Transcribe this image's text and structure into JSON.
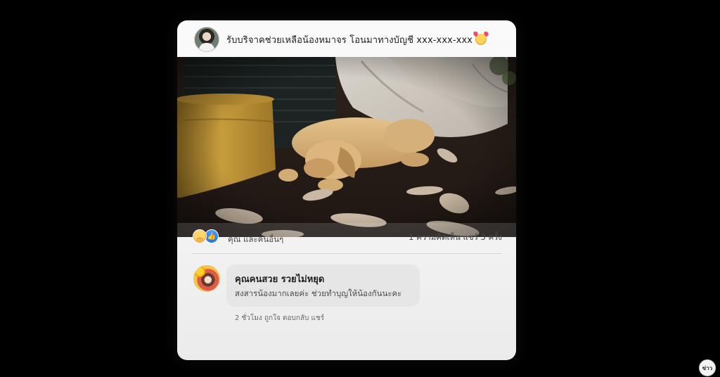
{
  "post": {
    "author_avatar_icon": "profile-photo-woman",
    "caption": "รับบริจาคช่วยเหลือน้องหมาจร โอนมาทางบัญชี xxx-xxx-xxx",
    "caption_emoji": "smiling-face-with-hearts-icon",
    "photo_description_icon": "puppy-photo",
    "reactions": {
      "icons": [
        "care-reaction-icon",
        "like-reaction-icon"
      ],
      "text": "คุณ และคนอื่นๆ"
    },
    "stats_text": "1 ความคิดเห็น แชร์ 3 ครั้ง"
  },
  "comment": {
    "avatar_icon": "profile-photo-sunflower",
    "author": "คุณคนสวย รวยไม่หยุด",
    "text": "สงสารน้องมากเลยค่ะ ช่วยทำบุญให้น้องกันนะคะ",
    "actions": "2 ชั่วโมง ถูกใจ ตอบกลับ แชร์"
  },
  "watermark": {
    "label": "ข่าว"
  },
  "colors": {
    "background": "#000000",
    "card": "#f5f5f5",
    "comment_bubble": "#e6e6e6",
    "like_blue": "#1877f2"
  }
}
